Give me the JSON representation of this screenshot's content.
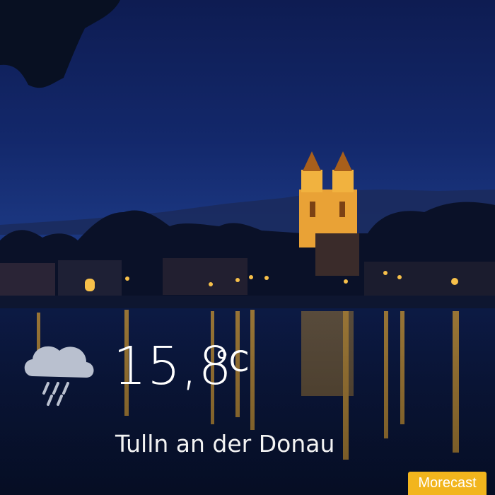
{
  "weather": {
    "condition_icon": "rain-cloud-icon",
    "temperature": "15,8",
    "unit": "°C",
    "location": "Tulln an der Donau"
  },
  "brand": {
    "label": "Morecast",
    "color": "#f2b51d"
  },
  "background": {
    "sky_color": "#13286b",
    "water_color": "#0a163a",
    "light_color": "#f7c04a"
  }
}
